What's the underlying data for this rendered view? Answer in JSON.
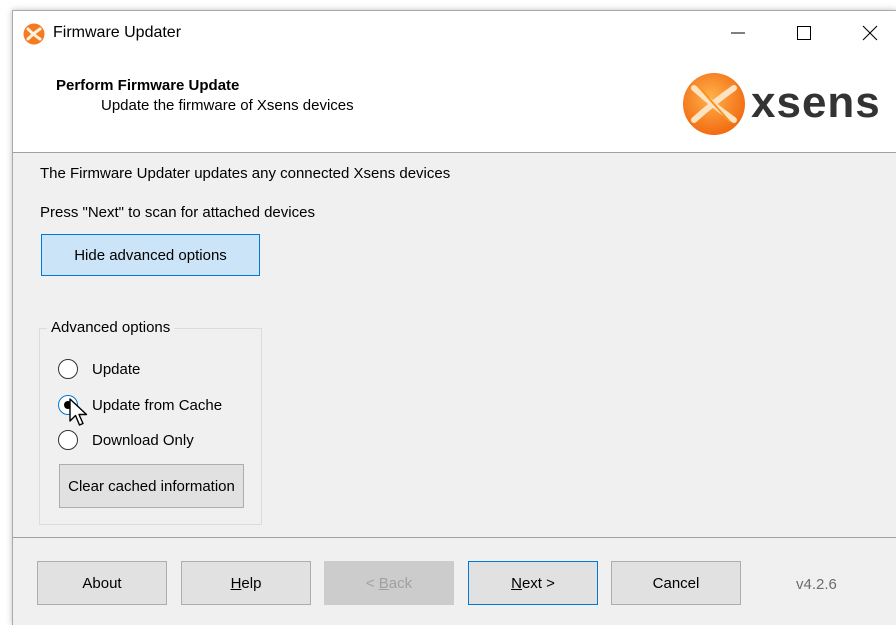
{
  "window": {
    "title": "Firmware Updater"
  },
  "header": {
    "title": "Perform Firmware Update",
    "subtitle": "Update the firmware of Xsens devices",
    "logo_text": "xsens"
  },
  "content": {
    "line1": "The Firmware Updater updates any connected Xsens devices",
    "line2": "Press \"Next\" to scan for attached devices",
    "advanced_toggle_label": "Hide advanced options"
  },
  "advanced": {
    "group_label": "Advanced options",
    "options": [
      {
        "label": "Update",
        "selected": false
      },
      {
        "label": "Update from Cache",
        "selected": true
      },
      {
        "label": "Download Only",
        "selected": false
      }
    ],
    "clear_label": "Clear cached information"
  },
  "footer": {
    "about": "About",
    "help_mnemonic": "H",
    "help_rest": "elp",
    "back_prefix": "< ",
    "back_mnemonic": "B",
    "back_rest": "ack",
    "next_mnemonic": "N",
    "next_rest": "ext >",
    "cancel": "Cancel",
    "version": "v4.2.6"
  },
  "colors": {
    "accent": "#0078d7",
    "logo_orange": "#f47b20",
    "window_bg": "#f0f0f0"
  }
}
